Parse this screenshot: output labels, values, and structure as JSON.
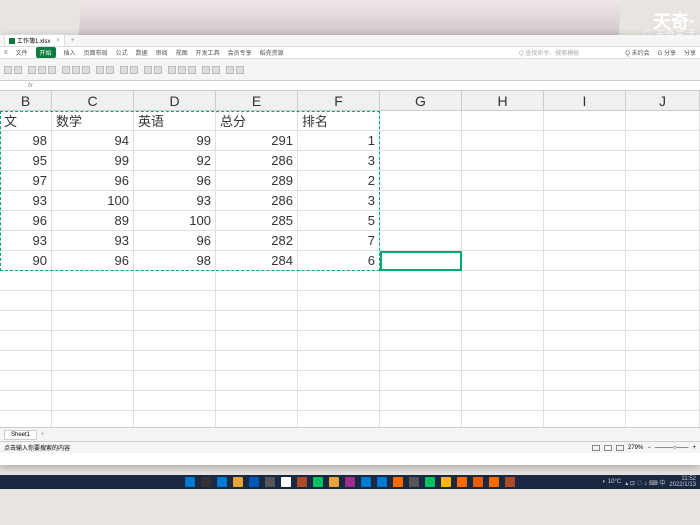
{
  "watermark": {
    "line1": "天奇·",
    "line2": "◎ 天奇生活"
  },
  "titlebar": {
    "filename": "工作簿1.xlsx"
  },
  "ribbon_tabs": [
    "文件",
    "开始",
    "插入",
    "页面布局",
    "公式",
    "数据",
    "审阅",
    "视图",
    "开发工具",
    "会员专享",
    "稻壳资源"
  ],
  "ribbon_right": [
    "Q 未约会",
    "G 分享",
    "分享"
  ],
  "search_hint": "Q 查找命令、搜索模板",
  "formula": {
    "name_box": "",
    "fx": "fx"
  },
  "columns": [
    "B",
    "C",
    "D",
    "E",
    "F",
    "G",
    "H",
    "I",
    "J"
  ],
  "col_widths": [
    "col-B",
    "col-C",
    "col-D",
    "col-E",
    "col-F",
    "col-G",
    "col-H",
    "col-I",
    "col-J"
  ],
  "headers": {
    "B": "文",
    "C": "数学",
    "D": "英语",
    "E": "总分",
    "F": "排名"
  },
  "rows": [
    {
      "B": 98,
      "C": 94,
      "D": 99,
      "E": 291,
      "F": 1
    },
    {
      "B": 95,
      "C": 99,
      "D": 92,
      "E": 286,
      "F": 3
    },
    {
      "B": 97,
      "C": 96,
      "D": 96,
      "E": 289,
      "F": 2
    },
    {
      "B": 93,
      "C": 100,
      "D": 93,
      "E": 286,
      "F": 3
    },
    {
      "B": 96,
      "C": 89,
      "D": 100,
      "E": 285,
      "F": 5
    },
    {
      "B": 93,
      "C": 93,
      "D": 96,
      "E": 282,
      "F": 7
    },
    {
      "B": 90,
      "C": 96,
      "D": 98,
      "E": 284,
      "F": 6
    }
  ],
  "sheet_tab": "Sheet1",
  "status": {
    "left": "点击输入你要搜索的内容",
    "zoom": "279%"
  },
  "taskbar": {
    "icons": [
      "#0078d4",
      "#333",
      "#0078d4",
      "#e8a33d",
      "#0057b8",
      "#555",
      "#fff",
      "#ad4a28",
      "#07c160",
      "#e8a33d",
      "#9b2d8e",
      "#0078d4",
      "#0078d4",
      "#ff6a00",
      "#555",
      "#07c160",
      "#ffb700",
      "#ff6a00",
      "#e85d00",
      "#ff6a00",
      "#ad4a28"
    ],
    "weather": "◐ 10°C",
    "time": "11:52",
    "date": "2022/1/13"
  }
}
